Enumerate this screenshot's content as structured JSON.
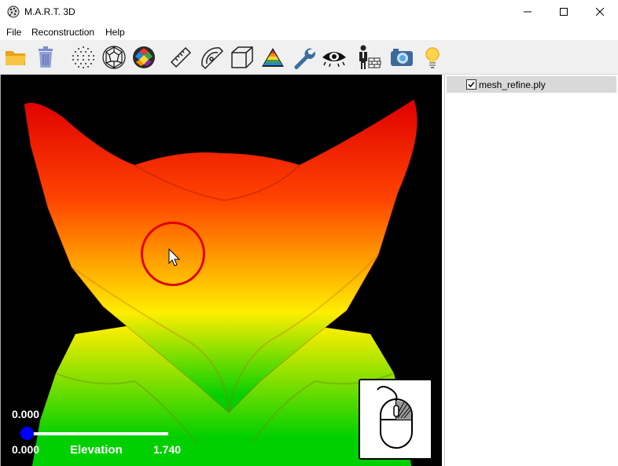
{
  "window": {
    "title": "M.A.R.T. 3D"
  },
  "menu": {
    "file": "File",
    "reconstruction": "Reconstruction",
    "help": "Help"
  },
  "toolbar": {
    "icons": [
      "open-folder-icon",
      "trash-icon",
      "point-cloud-icon",
      "wireframe-sphere-icon",
      "colored-mesh-sphere-icon",
      "ruler-icon",
      "protractor-icon",
      "cube-icon",
      "elevation-triangle-icon",
      "wrench-icon",
      "eye-icon",
      "worker-wall-icon",
      "camera-icon",
      "lightbulb-icon"
    ]
  },
  "viewport": {
    "colormap": [
      "#00d000",
      "#ffee00",
      "#ff4400",
      "#e00000"
    ]
  },
  "slider": {
    "current_value": "0.000",
    "min": "0.000",
    "max": "1.740",
    "label": "Elevation",
    "position": 0.0,
    "thumb_color": "#0000ff"
  },
  "scene_tree": {
    "items": [
      {
        "label": "mesh_refine.ply",
        "checked": true
      }
    ]
  }
}
